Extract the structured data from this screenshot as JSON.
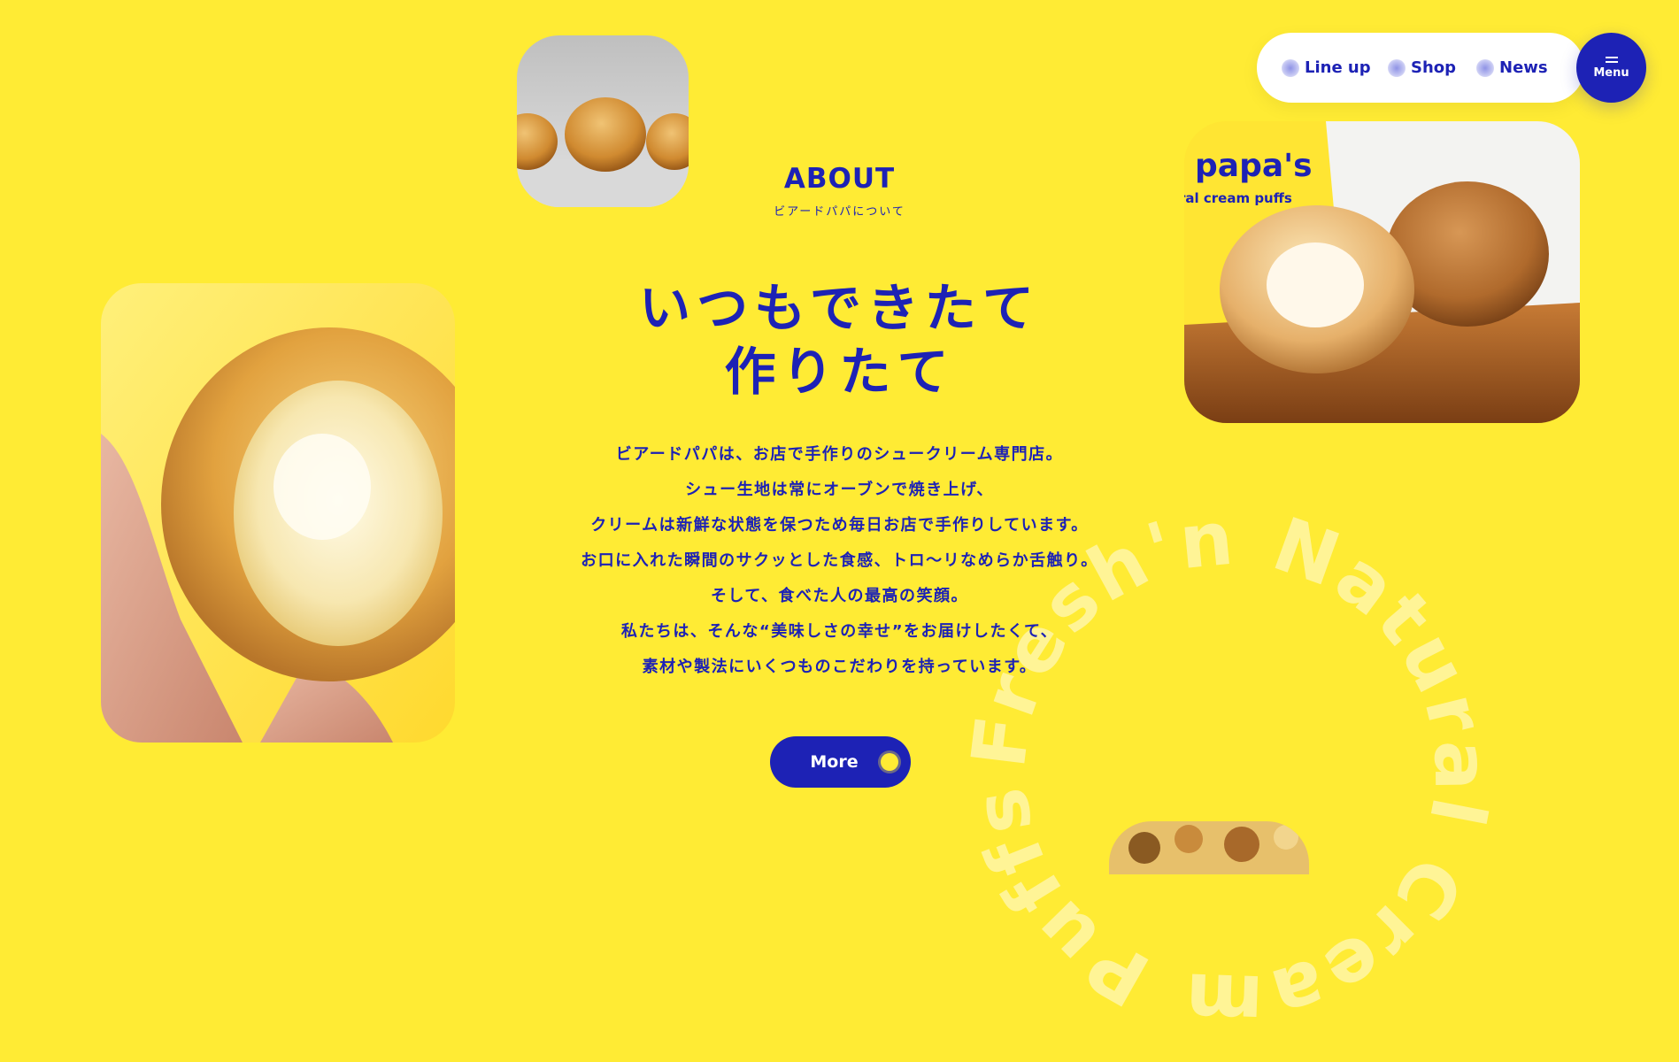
{
  "nav": {
    "items": [
      {
        "label": "Line up",
        "icon": "bubble-icon"
      },
      {
        "label": "Shop",
        "icon": "bubble-icon"
      },
      {
        "label": "News",
        "icon": "bubble-icon"
      }
    ],
    "menu_label": "Menu"
  },
  "about": {
    "title": "ABOUT",
    "subtitle": "ビアードパパについて",
    "headline": [
      "いつもできたて",
      "作りたて"
    ],
    "body": [
      "ビアードパパは、お店で手作りのシュークリーム専門店。",
      "シュー生地は常にオーブンで焼き上げ、",
      "クリームは新鮮な状態を保つため毎日お店で手作りしています。",
      "お口に入れた瞬間のサクッとした食感、トロ〜リなめらか舌触り。",
      "そして、食べた人の最高の笑顔。",
      "私たちは、そんな“美味しさの幸せ”をお届けしたくて、",
      "素材や製法にいくつものこだわりを持っています。"
    ],
    "more_label": "More"
  },
  "decor": {
    "circle_text": "Fresh'n Natural Cream Puffs ",
    "photo_text_brand": "papa's",
    "photo_text_tagline": "ral cream puffs"
  },
  "colors": {
    "background": "#ffeb34",
    "primary": "#1d22b5",
    "white": "#ffffff"
  }
}
